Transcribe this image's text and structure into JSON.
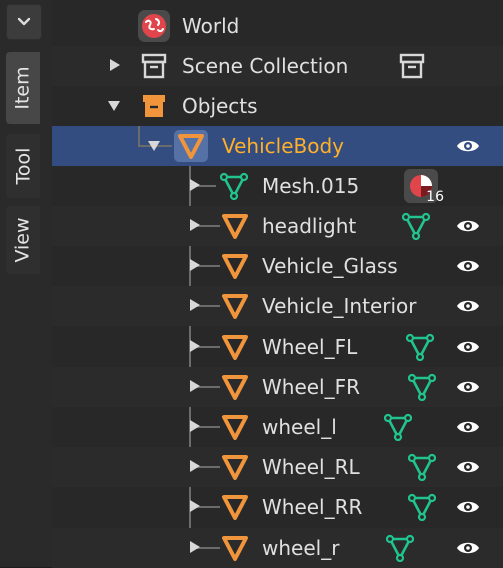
{
  "tabs": {
    "dropdown_icon": "chevron-down-icon",
    "items": [
      {
        "label": "Item",
        "active": true
      },
      {
        "label": "Tool",
        "active": false
      },
      {
        "label": "View",
        "active": false
      }
    ]
  },
  "outliner": {
    "world": {
      "label": "World",
      "icon": "world-icon"
    },
    "scene_collection": {
      "label": "Scene Collection",
      "icon": "collection-icon"
    },
    "objects": {
      "label": "Objects",
      "icon": "collection-icon"
    },
    "active_object": {
      "label": "VehicleBody",
      "icon": "object-icon"
    },
    "mesh": {
      "label": "Mesh.015",
      "icon": "mesh-data-icon",
      "material_badge_count": "16"
    },
    "children": [
      {
        "label": "headlight"
      },
      {
        "label": "Vehicle_Glass"
      },
      {
        "label": "Vehicle_Interior"
      },
      {
        "label": "Wheel_FL"
      },
      {
        "label": "Wheel_FR"
      },
      {
        "label": "wheel_l"
      },
      {
        "label": "Wheel_RL"
      },
      {
        "label": "Wheel_RR"
      },
      {
        "label": "wheel_r"
      }
    ]
  },
  "colors": {
    "selected_row": "#334d80",
    "active_text": "#ffaf29",
    "object_orange": "#f0953c",
    "mesh_green": "#21c48f"
  }
}
